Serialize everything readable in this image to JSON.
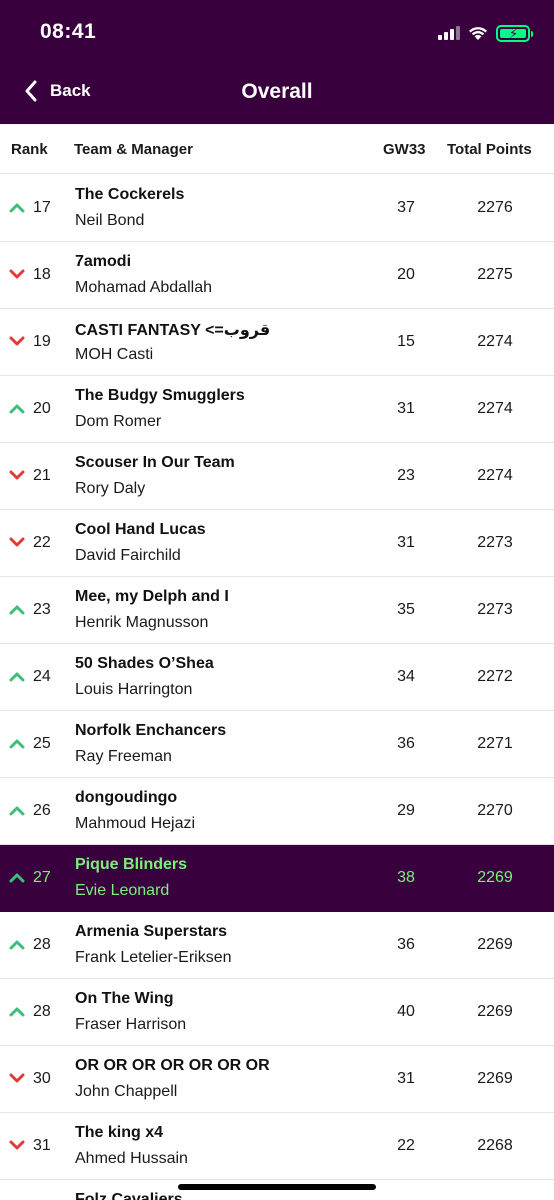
{
  "status_bar": {
    "time": "08:41"
  },
  "header": {
    "back_label": "Back",
    "title": "Overall"
  },
  "columns": {
    "rank": "Rank",
    "team": "Team & Manager",
    "gw": "GW33",
    "total": "Total Points"
  },
  "colors": {
    "header_bg": "#38003c",
    "up": "#3cbf7a",
    "down": "#e53935",
    "highlight_text": "#7cf07a",
    "battery": "#00ff87"
  },
  "rows": [
    {
      "movement": "up",
      "rank": "17",
      "team": "The Cockerels",
      "manager": "Neil Bond",
      "gw": "37",
      "total": "2276"
    },
    {
      "movement": "down",
      "rank": "18",
      "team": "7amodi",
      "manager": "Mohamad Abdallah",
      "gw": "20",
      "total": "2275"
    },
    {
      "movement": "down",
      "rank": "19",
      "team": "CASTI FANTASY <=قروب",
      "manager": "MOH Casti",
      "gw": "15",
      "total": "2274"
    },
    {
      "movement": "up",
      "rank": "20",
      "team": "The Budgy Smugglers",
      "manager": "Dom Romer",
      "gw": "31",
      "total": "2274"
    },
    {
      "movement": "down",
      "rank": "21",
      "team": "Scouser In Our Team",
      "manager": "Rory Daly",
      "gw": "23",
      "total": "2274"
    },
    {
      "movement": "down",
      "rank": "22",
      "team": "Cool Hand Lucas",
      "manager": "David Fairchild",
      "gw": "31",
      "total": "2273"
    },
    {
      "movement": "up",
      "rank": "23",
      "team": "Mee, my Delph and I",
      "manager": "Henrik Magnusson",
      "gw": "35",
      "total": "2273"
    },
    {
      "movement": "up",
      "rank": "24",
      "team": "50 Shades O’Shea",
      "manager": "Louis Harrington",
      "gw": "34",
      "total": "2272"
    },
    {
      "movement": "up",
      "rank": "25",
      "team": "Norfolk Enchancers",
      "manager": "Ray Freeman",
      "gw": "36",
      "total": "2271"
    },
    {
      "movement": "up",
      "rank": "26",
      "team": "dongoudingo",
      "manager": "Mahmoud Hejazi",
      "gw": "29",
      "total": "2270"
    },
    {
      "movement": "up",
      "rank": "27",
      "team": "Pique Blinders",
      "manager": "Evie Leonard",
      "gw": "38",
      "total": "2269",
      "highlight": true
    },
    {
      "movement": "up",
      "rank": "28",
      "team": "Armenia Superstars",
      "manager": "Frank Letelier-Eriksen",
      "gw": "36",
      "total": "2269"
    },
    {
      "movement": "up",
      "rank": "28",
      "team": "On The Wing",
      "manager": "Fraser Harrison",
      "gw": "40",
      "total": "2269"
    },
    {
      "movement": "down",
      "rank": "30",
      "team": "OR OR OR OR OR OR OR",
      "manager": "John Chappell",
      "gw": "31",
      "total": "2269"
    },
    {
      "movement": "down",
      "rank": "31",
      "team": "The king x4",
      "manager": "Ahmed Hussain",
      "gw": "22",
      "total": "2268"
    },
    {
      "movement": "",
      "rank": "",
      "team": "Folz Cavaliers",
      "manager": "",
      "gw": "",
      "total": ""
    }
  ]
}
